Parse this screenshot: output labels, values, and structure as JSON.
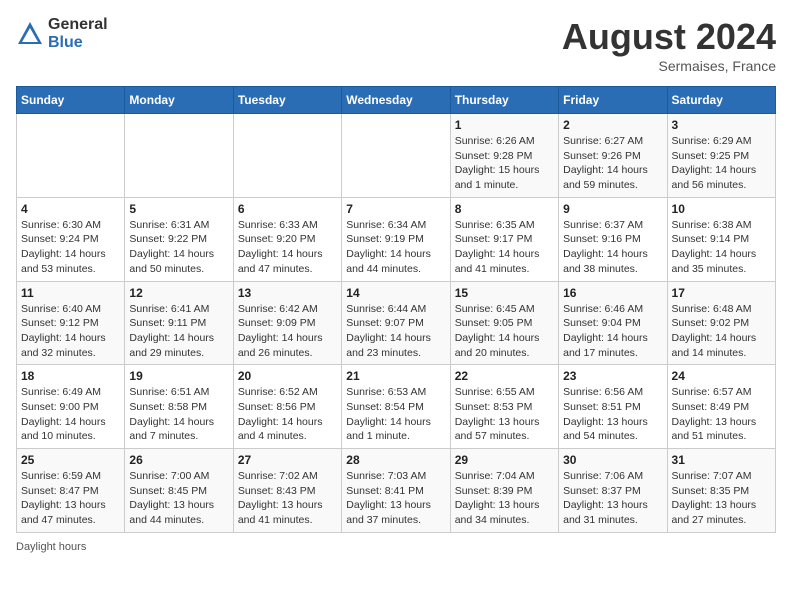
{
  "header": {
    "logo_general": "General",
    "logo_blue": "Blue",
    "month_year": "August 2024",
    "location": "Sermaises, France"
  },
  "footer": {
    "daylight_label": "Daylight hours"
  },
  "weekdays": [
    "Sunday",
    "Monday",
    "Tuesday",
    "Wednesday",
    "Thursday",
    "Friday",
    "Saturday"
  ],
  "weeks": [
    [
      {
        "day": "",
        "info": ""
      },
      {
        "day": "",
        "info": ""
      },
      {
        "day": "",
        "info": ""
      },
      {
        "day": "",
        "info": ""
      },
      {
        "day": "1",
        "info": "Sunrise: 6:26 AM\nSunset: 9:28 PM\nDaylight: 15 hours and 1 minute."
      },
      {
        "day": "2",
        "info": "Sunrise: 6:27 AM\nSunset: 9:26 PM\nDaylight: 14 hours and 59 minutes."
      },
      {
        "day": "3",
        "info": "Sunrise: 6:29 AM\nSunset: 9:25 PM\nDaylight: 14 hours and 56 minutes."
      }
    ],
    [
      {
        "day": "4",
        "info": "Sunrise: 6:30 AM\nSunset: 9:24 PM\nDaylight: 14 hours and 53 minutes."
      },
      {
        "day": "5",
        "info": "Sunrise: 6:31 AM\nSunset: 9:22 PM\nDaylight: 14 hours and 50 minutes."
      },
      {
        "day": "6",
        "info": "Sunrise: 6:33 AM\nSunset: 9:20 PM\nDaylight: 14 hours and 47 minutes."
      },
      {
        "day": "7",
        "info": "Sunrise: 6:34 AM\nSunset: 9:19 PM\nDaylight: 14 hours and 44 minutes."
      },
      {
        "day": "8",
        "info": "Sunrise: 6:35 AM\nSunset: 9:17 PM\nDaylight: 14 hours and 41 minutes."
      },
      {
        "day": "9",
        "info": "Sunrise: 6:37 AM\nSunset: 9:16 PM\nDaylight: 14 hours and 38 minutes."
      },
      {
        "day": "10",
        "info": "Sunrise: 6:38 AM\nSunset: 9:14 PM\nDaylight: 14 hours and 35 minutes."
      }
    ],
    [
      {
        "day": "11",
        "info": "Sunrise: 6:40 AM\nSunset: 9:12 PM\nDaylight: 14 hours and 32 minutes."
      },
      {
        "day": "12",
        "info": "Sunrise: 6:41 AM\nSunset: 9:11 PM\nDaylight: 14 hours and 29 minutes."
      },
      {
        "day": "13",
        "info": "Sunrise: 6:42 AM\nSunset: 9:09 PM\nDaylight: 14 hours and 26 minutes."
      },
      {
        "day": "14",
        "info": "Sunrise: 6:44 AM\nSunset: 9:07 PM\nDaylight: 14 hours and 23 minutes."
      },
      {
        "day": "15",
        "info": "Sunrise: 6:45 AM\nSunset: 9:05 PM\nDaylight: 14 hours and 20 minutes."
      },
      {
        "day": "16",
        "info": "Sunrise: 6:46 AM\nSunset: 9:04 PM\nDaylight: 14 hours and 17 minutes."
      },
      {
        "day": "17",
        "info": "Sunrise: 6:48 AM\nSunset: 9:02 PM\nDaylight: 14 hours and 14 minutes."
      }
    ],
    [
      {
        "day": "18",
        "info": "Sunrise: 6:49 AM\nSunset: 9:00 PM\nDaylight: 14 hours and 10 minutes."
      },
      {
        "day": "19",
        "info": "Sunrise: 6:51 AM\nSunset: 8:58 PM\nDaylight: 14 hours and 7 minutes."
      },
      {
        "day": "20",
        "info": "Sunrise: 6:52 AM\nSunset: 8:56 PM\nDaylight: 14 hours and 4 minutes."
      },
      {
        "day": "21",
        "info": "Sunrise: 6:53 AM\nSunset: 8:54 PM\nDaylight: 14 hours and 1 minute."
      },
      {
        "day": "22",
        "info": "Sunrise: 6:55 AM\nSunset: 8:53 PM\nDaylight: 13 hours and 57 minutes."
      },
      {
        "day": "23",
        "info": "Sunrise: 6:56 AM\nSunset: 8:51 PM\nDaylight: 13 hours and 54 minutes."
      },
      {
        "day": "24",
        "info": "Sunrise: 6:57 AM\nSunset: 8:49 PM\nDaylight: 13 hours and 51 minutes."
      }
    ],
    [
      {
        "day": "25",
        "info": "Sunrise: 6:59 AM\nSunset: 8:47 PM\nDaylight: 13 hours and 47 minutes."
      },
      {
        "day": "26",
        "info": "Sunrise: 7:00 AM\nSunset: 8:45 PM\nDaylight: 13 hours and 44 minutes."
      },
      {
        "day": "27",
        "info": "Sunrise: 7:02 AM\nSunset: 8:43 PM\nDaylight: 13 hours and 41 minutes."
      },
      {
        "day": "28",
        "info": "Sunrise: 7:03 AM\nSunset: 8:41 PM\nDaylight: 13 hours and 37 minutes."
      },
      {
        "day": "29",
        "info": "Sunrise: 7:04 AM\nSunset: 8:39 PM\nDaylight: 13 hours and 34 minutes."
      },
      {
        "day": "30",
        "info": "Sunrise: 7:06 AM\nSunset: 8:37 PM\nDaylight: 13 hours and 31 minutes."
      },
      {
        "day": "31",
        "info": "Sunrise: 7:07 AM\nSunset: 8:35 PM\nDaylight: 13 hours and 27 minutes."
      }
    ]
  ]
}
